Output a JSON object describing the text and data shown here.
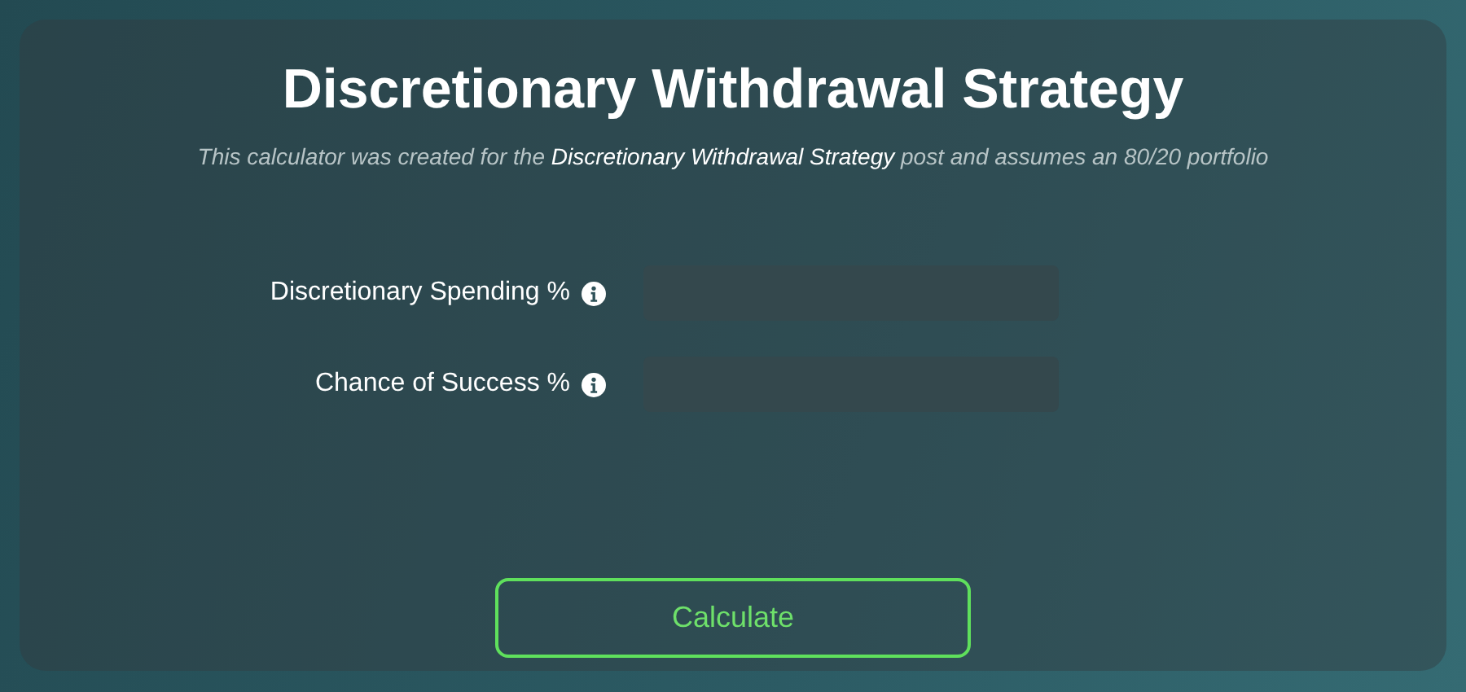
{
  "title": "Discretionary Withdrawal Strategy",
  "subtitle": {
    "before": "This calculator was created for the",
    "link": "Discretionary Withdrawal Strategy",
    "after": "post and assumes an 80/20 portfolio"
  },
  "fields": [
    {
      "label": "Discretionary Spending %",
      "info": true
    },
    {
      "label": "Chance of Success %",
      "info": true
    }
  ],
  "button": "Calculate"
}
